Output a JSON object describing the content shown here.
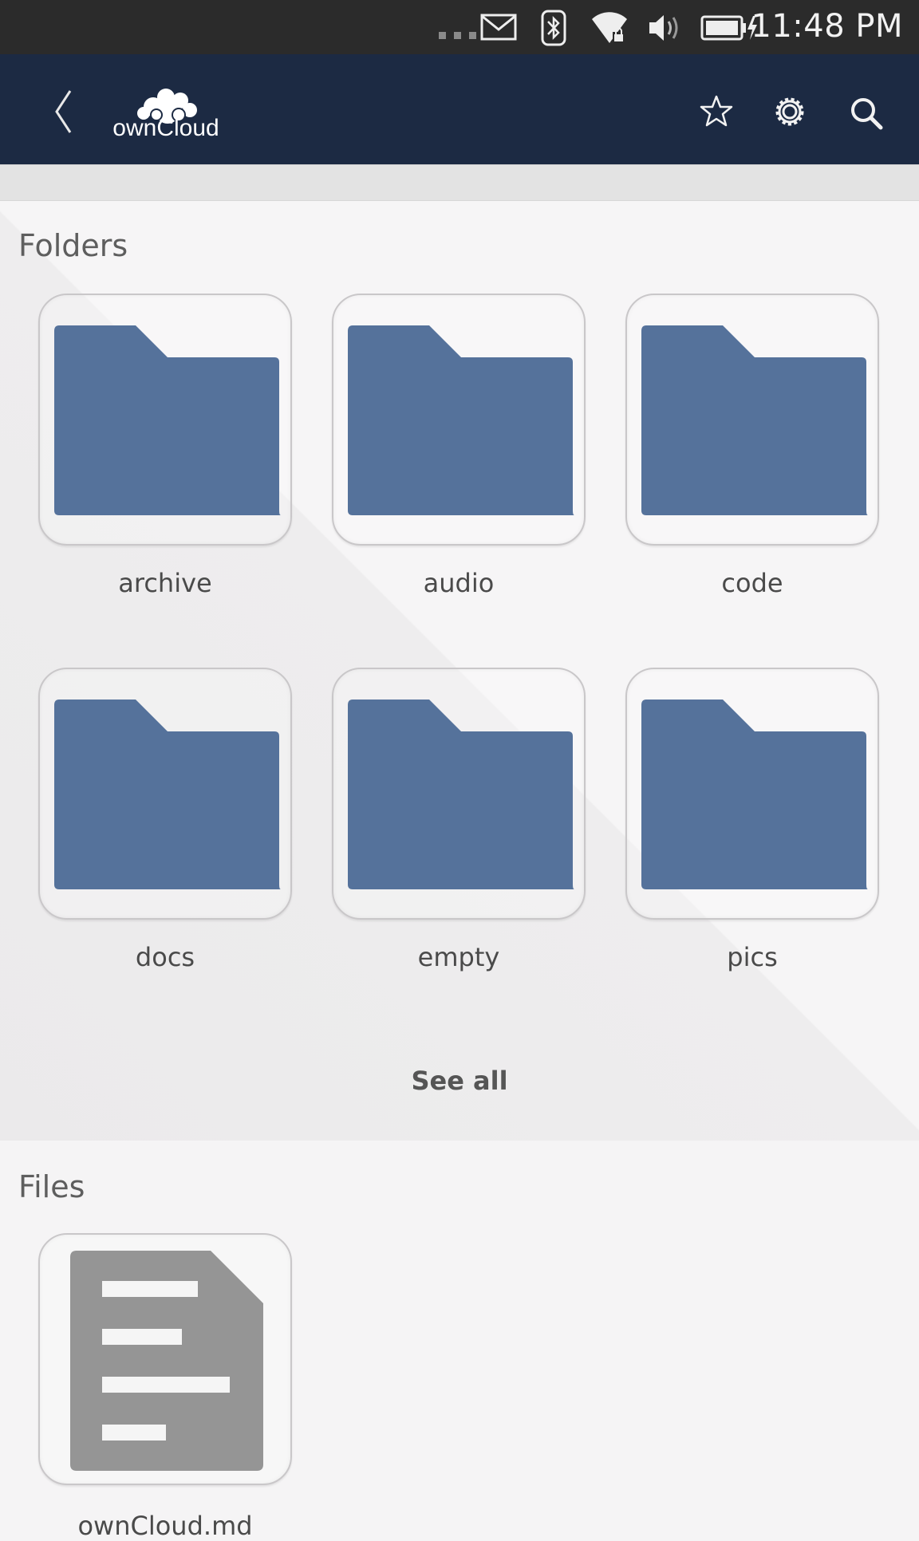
{
  "status_bar": {
    "time": "11:48 PM",
    "icons": [
      "dots-icon",
      "mail-icon",
      "bluetooth-icon",
      "wifi-icon",
      "volume-icon",
      "battery-charging-icon"
    ]
  },
  "header": {
    "logo_text": "ownCloud",
    "back_icon": "chevron-left-icon",
    "actions": [
      "star-icon",
      "gear-icon",
      "search-icon"
    ]
  },
  "folders": {
    "title": "Folders",
    "items": [
      {
        "label": "archive"
      },
      {
        "label": "audio"
      },
      {
        "label": "code"
      },
      {
        "label": "docs"
      },
      {
        "label": "empty"
      },
      {
        "label": "pics"
      }
    ],
    "see_all": "See all"
  },
  "files": {
    "title": "Files",
    "items": [
      {
        "label": "ownCloud.md"
      }
    ]
  },
  "colors": {
    "header_bg": "#1c2a43",
    "folder_icon": "#55729b",
    "file_icon": "#959595",
    "status_bar_bg": "#2b2b2b"
  }
}
